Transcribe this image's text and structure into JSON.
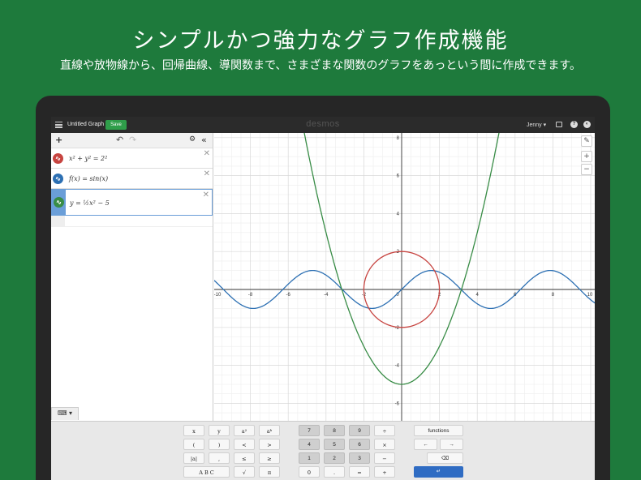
{
  "banner": {
    "headline": "シンプルかつ強力なグラフ作成機能",
    "subline": "直線や放物線から、回帰曲線、導関数まで、さまざまな関数のグラフをあっという間に作成できます。"
  },
  "topbar": {
    "title": "Untitled Graph",
    "save_label": "Save",
    "logo": "desmos",
    "user": "Jenny ▾"
  },
  "expressions": [
    {
      "formula": "x² + y² = 2²",
      "color": "#c74440"
    },
    {
      "formula": "f(x) = sin(x)",
      "color": "#2d70b3"
    },
    {
      "formula": "y = ½x² − 5",
      "color": "#388c46"
    }
  ],
  "graph": {
    "x_ticks": [
      "-10",
      "-8",
      "-6",
      "-4",
      "-2",
      "0",
      "2",
      "4",
      "6",
      "8",
      "10"
    ],
    "y_ticks": [
      "8",
      "6",
      "4",
      "2",
      "-2",
      "-4",
      "-6",
      "-8"
    ],
    "xlim": [
      -10,
      10
    ],
    "ylim": [
      -10,
      10
    ],
    "grid": true,
    "colors": {
      "circle": "#c74440",
      "sine": "#2d70b3",
      "parabola": "#388c46"
    }
  },
  "keypad": {
    "func_keys": [
      "x",
      "y",
      "a²",
      "aᵇ",
      "(",
      ")",
      "<",
      ">",
      "|a|",
      ",",
      "≤",
      "≥",
      "A B C",
      "√",
      "π"
    ],
    "num_keys": [
      "7",
      "8",
      "9",
      "÷",
      "4",
      "5",
      "6",
      "×",
      "1",
      "2",
      "3",
      "−",
      "0",
      ".",
      "=",
      "+"
    ],
    "functions_label": "functions",
    "left_arrow": "←",
    "right_arrow": "→",
    "backspace": "⌫",
    "enter": "↵"
  }
}
